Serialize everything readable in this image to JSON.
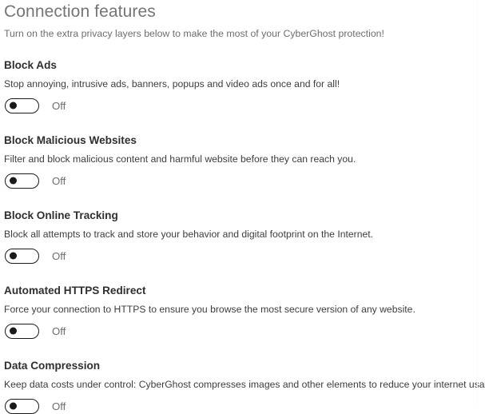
{
  "header": {
    "title": "Connection features",
    "subtitle": "Turn on the extra privacy layers below to make the most of your CyberGhost protection!"
  },
  "colors": {
    "background": "#ffffff",
    "title_text": "#757575",
    "subtitle_text": "#6e6e6e",
    "feature_title_text": "#2f2f2f",
    "feature_desc_text": "#3d3d3d",
    "toggle_outline": "#1a1a1a",
    "toggle_label_text": "#6f6f6f"
  },
  "features": [
    {
      "title": "Block Ads",
      "description": "Stop annoying, intrusive ads, banners, popups and video ads once and for all!",
      "toggle_state": "Off"
    },
    {
      "title": "Block Malicious Websites",
      "description": "Filter and block malicious content and harmful website before they can reach you.",
      "toggle_state": "Off"
    },
    {
      "title": "Block Online Tracking",
      "description": "Block all attempts to track and store your behavior and digital footprint on the Internet.",
      "toggle_state": "Off"
    },
    {
      "title": "Automated HTTPS Redirect",
      "description": "Force your connection to HTTPS to ensure you browse the most secure version of any website.",
      "toggle_state": "Off"
    },
    {
      "title": "Data Compression",
      "description": "Keep data costs under control: CyberGhost compresses images and other elements to reduce your internet usage.",
      "toggle_state": "Off"
    }
  ]
}
